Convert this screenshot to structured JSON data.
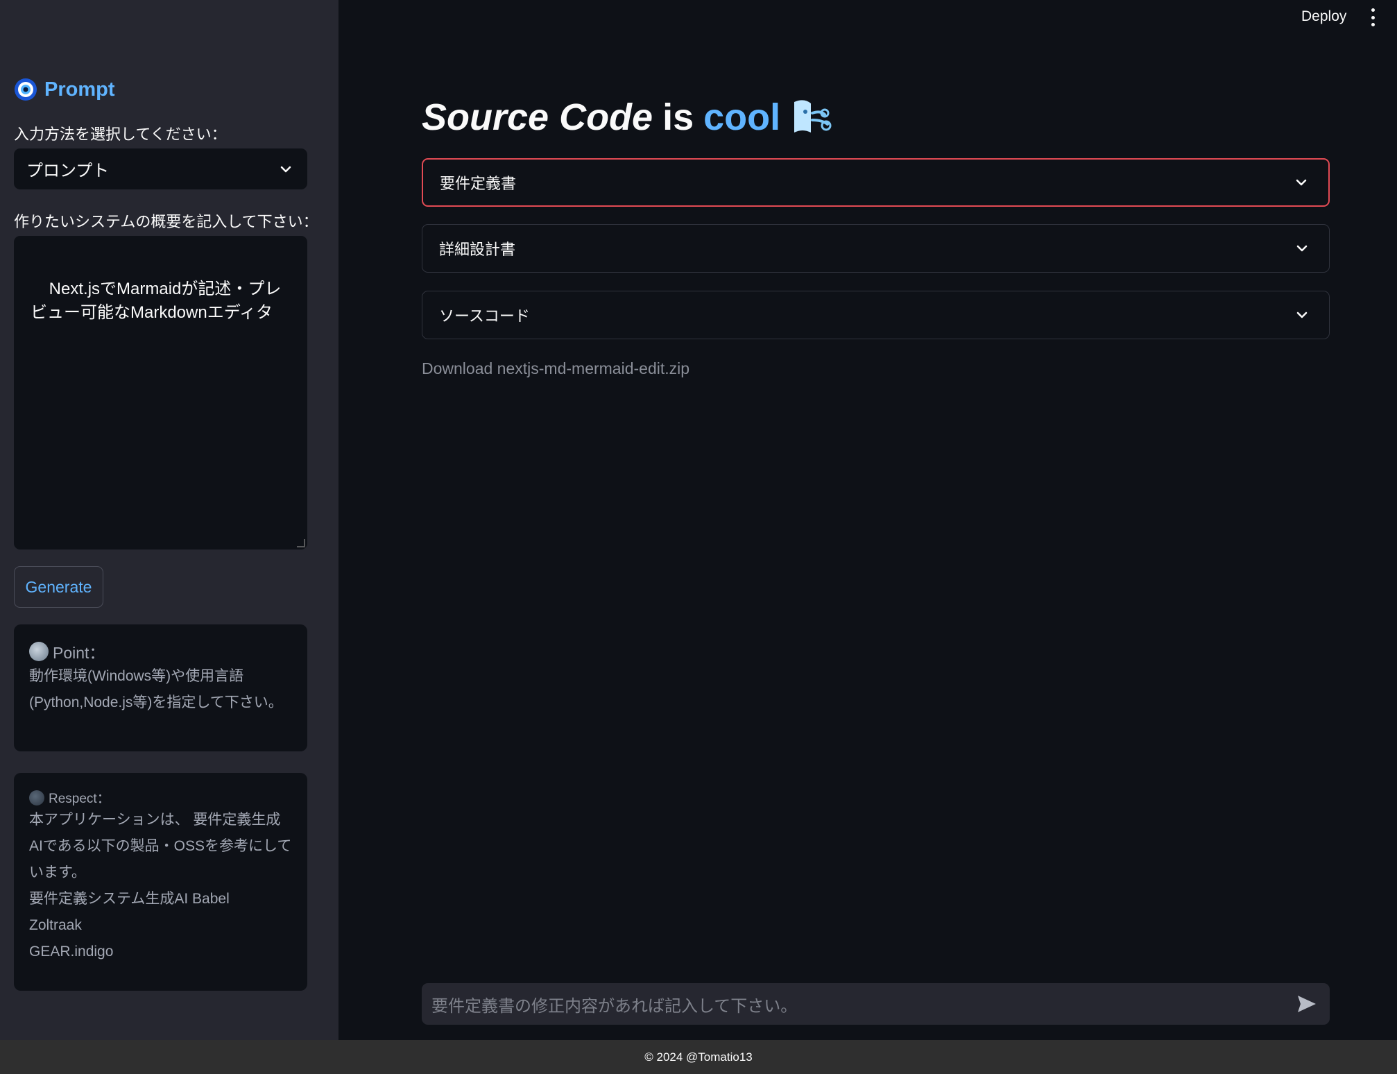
{
  "header": {
    "deploy_label": "Deploy"
  },
  "sidebar": {
    "title": "Prompt",
    "input_method_label": "入力方法を選択してください：",
    "input_method_selected": "プロンプト",
    "overview_label": "作りたいシステムの概要を記入して下さい：",
    "overview_text": "Next.jsでMarmaidが記述・プレビュー可能なMarkdownエディタ",
    "generate_label": "Generate",
    "point": {
      "title": "Point：",
      "body": "動作環境(Windows等)や使用言語(Python,Node.js等)を指定して下さい。"
    },
    "respect": {
      "title": "Respect：",
      "body": "本アプリケーションは、 要件定義生成AIである以下の製品・OSSを参考にしています。",
      "items": [
        "要件定義システム生成AI Babel",
        "Zoltraak",
        "GEAR.indigo"
      ]
    }
  },
  "main": {
    "title_part1": "Source Code",
    "title_part2": "is",
    "title_part3": "cool",
    "expanders": [
      "要件定義書",
      "詳細設計書",
      "ソースコード"
    ],
    "download_text": "Download nextjs-md-mermaid-edit.zip",
    "chat_placeholder": "要件定義書の修正内容があれば記入して下さい。"
  },
  "footer": {
    "text": "© 2024 @Tomatio13"
  },
  "colors": {
    "accent": "#60b4ff",
    "active_border": "#e24b54",
    "background": "#0e1117",
    "sidebar": "#262730"
  }
}
